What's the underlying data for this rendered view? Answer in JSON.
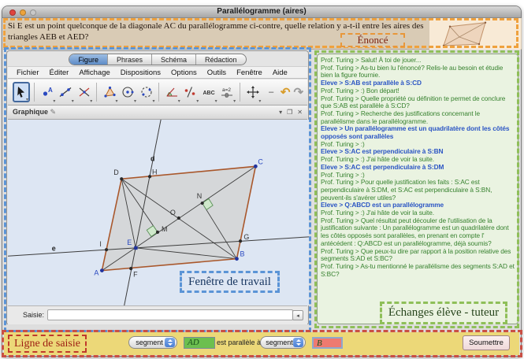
{
  "title_bar": {
    "title": "Parallélogramme (aires)"
  },
  "enonce": {
    "label": "Énoncé",
    "text": "Si E est un point quelconque de la diagonale AC du parallélogramme ci-contre, quelle relation y a-t-il entre les aires des triangles AEB et AED?"
  },
  "workspace": {
    "work_window_label": "Fenêtre de travail",
    "tabs": [
      {
        "label": "Figure",
        "state": "selected"
      },
      {
        "label": "Phrases",
        "state": ""
      },
      {
        "label": "Schéma",
        "state": ""
      },
      {
        "label": "Rédaction",
        "state": ""
      }
    ],
    "menus": [
      "Fichier",
      "Éditer",
      "Affichage",
      "Dispositions",
      "Options",
      "Outils",
      "Fenêtre",
      "Aide"
    ],
    "toolbar_tools": [
      "move",
      "point",
      "line",
      "perpendicular-line",
      "polygon",
      "circle",
      "conic",
      "angle",
      "reflect",
      "text",
      "slider",
      "move-view"
    ],
    "graphique_title": "Graphique",
    "saisie_label": "Saisie:",
    "saisie_value": "",
    "figure_labels": {
      "A": "A",
      "B": "B",
      "C": "C",
      "D": "D",
      "E": "E",
      "F": "F",
      "G": "G",
      "H": "H",
      "I": "I",
      "M": "M",
      "N": "N",
      "O": "O",
      "d": "d",
      "e": "e"
    }
  },
  "chat": {
    "label": "Échanges élève - tuteur",
    "messages": [
      {
        "speaker": "prof",
        "text": "Prof. Turing >  Salut! À toi de jouer..."
      },
      {
        "speaker": "prof",
        "text": "Prof. Turing >  As-tu bien lu l'énoncé? Relis-le au besoin et étudie bien la figure fournie."
      },
      {
        "speaker": "eleve",
        "text": "Eleve >  S:AB est parallèle à S:CD"
      },
      {
        "speaker": "prof",
        "text": "Prof. Turing >  :)  Bon départ!"
      },
      {
        "speaker": "prof",
        "text": "Prof. Turing >  Quelle propriété ou définition te permet de conclure que S:AB est parallèle à S:CD?"
      },
      {
        "speaker": "prof",
        "text": "Prof. Turing >  Recherche des justifications concernant le parallélisme dans le parallélogramme."
      },
      {
        "speaker": "eleve",
        "text": "Eleve >  Un parallélogramme est un quadrilatère dont les côtés opposés sont parallèles"
      },
      {
        "speaker": "prof",
        "text": "Prof. Turing >  :)"
      },
      {
        "speaker": "eleve",
        "text": "Eleve >  S:AC est perpendiculaire à S:BN"
      },
      {
        "speaker": "prof",
        "text": "Prof. Turing >  :)  J'ai hâte de voir la suite."
      },
      {
        "speaker": "eleve",
        "text": "Eleve >  S:AC est perpendiculaire à S:DM"
      },
      {
        "speaker": "prof",
        "text": "Prof. Turing >  :)"
      },
      {
        "speaker": "prof",
        "text": "Prof. Turing >  Pour quelle justification les faits : S:AC est perpendiculaire à S:DM, et S:AC est perpendiculaire à S:BN, peuvent-ils s'avérer utiles?"
      },
      {
        "speaker": "eleve",
        "text": "Eleve >  Q:ABCD est un parallélogramme"
      },
      {
        "speaker": "prof",
        "text": "Prof. Turing >  :)  J'ai hâte de voir la suite."
      },
      {
        "speaker": "prof",
        "text": "Prof. Turing >  Quel résultat peut découler de l'utilisation de la justification suivante : Un parallélogramme est un quadrilatère dont les côtés opposés sont parallèles, en prenant en compte l' antécédent : Q:ABCD est un parallélogramme, déjà soumis?"
      },
      {
        "speaker": "prof",
        "text": "Prof. Turing >  Que peux-tu dire par rapport à la position relative des segments S:AD et S:BC?"
      },
      {
        "speaker": "prof",
        "text": "Prof. Turing >  As-tu mentionné le parallélisme des segments S:AD et S:BC?"
      }
    ]
  },
  "input_bar": {
    "label": "Ligne de saisie",
    "selector1": "segment",
    "operand1": "AD",
    "relation": "est parallèle à",
    "selector2": "segment",
    "operand2": "B",
    "submit": "Soumettre"
  },
  "colors": {
    "enonce_frame": "#efa13d",
    "work_frame": "#5b94d6",
    "chat_frame": "#8fbf59",
    "input_frame": "#c94f44",
    "prof_text": "#37822f",
    "eleve_text": "#2b55c4",
    "parallelogram_edge": "#a9572b",
    "canvas_bg": "#dde6f3",
    "input_bar_bg": "#ecd878"
  }
}
